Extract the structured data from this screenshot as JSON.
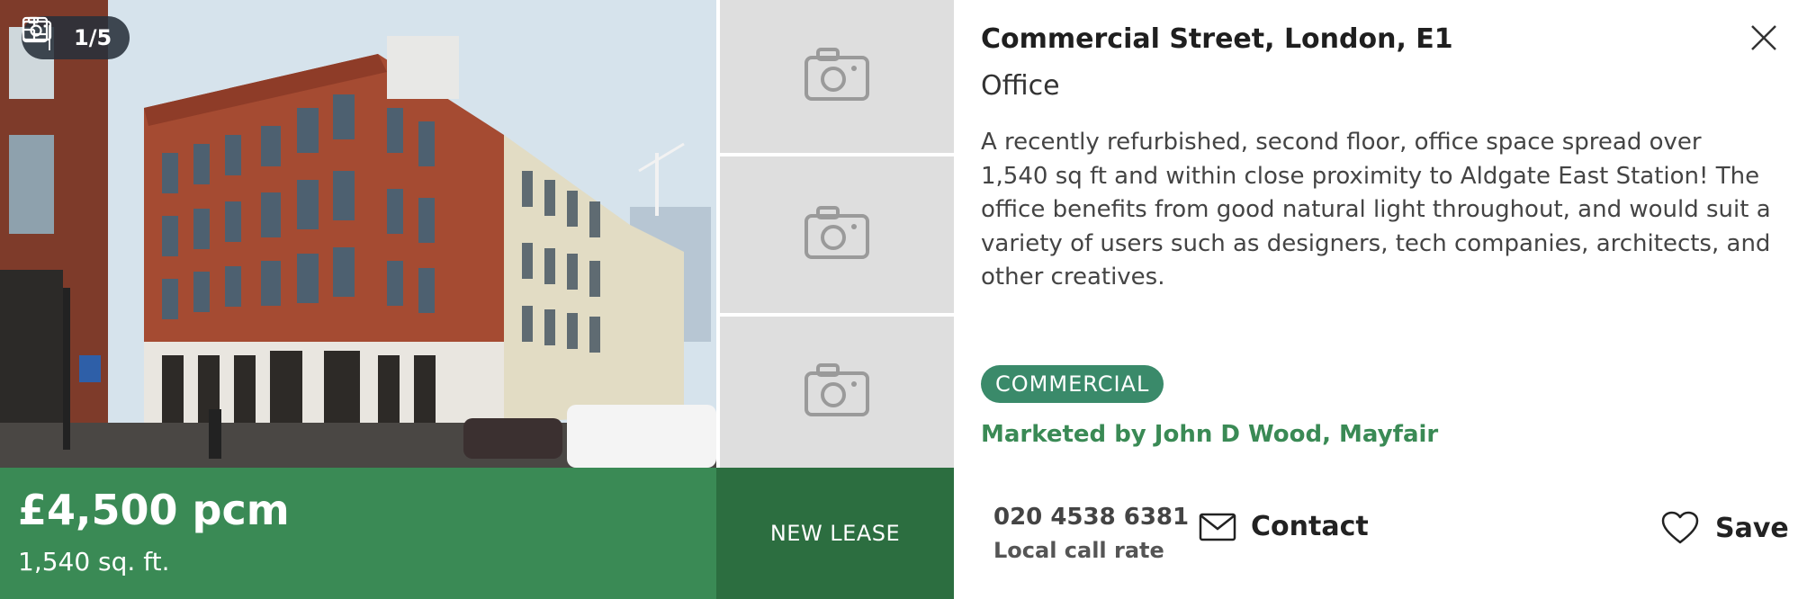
{
  "gallery": {
    "counter": "1/5"
  },
  "listing": {
    "price": "£4,500 pcm",
    "size": "1,540 sq. ft.",
    "lease_type": "NEW LEASE",
    "address": "Commercial Street, London, E1",
    "property_type": "Office",
    "description": "A recently refurbished, second floor, office space spread over 1,540 sq ft and within close proximity to Aldgate East Station! The office benefits from good natural light throughout, and would suit a variety of users such as designers, tech companies, architects, and other creatives.",
    "badge": "COMMERCIAL",
    "marketed_by": "Marketed by John D Wood, Mayfair"
  },
  "contact": {
    "phone": "020 4538 6381",
    "phone_note": "Local call rate",
    "contact_label": "Contact",
    "save_label": "Save"
  },
  "icons": {
    "floorplan": "floorplan-icon",
    "camera": "camera-icon",
    "close": "close-icon",
    "mail": "mail-icon",
    "heart": "heart-icon"
  },
  "colors": {
    "price_bar": "#3a8a55",
    "lease_bar": "#2c6e40",
    "badge": "#3a8a6a",
    "agent_text": "#3a8a55"
  }
}
